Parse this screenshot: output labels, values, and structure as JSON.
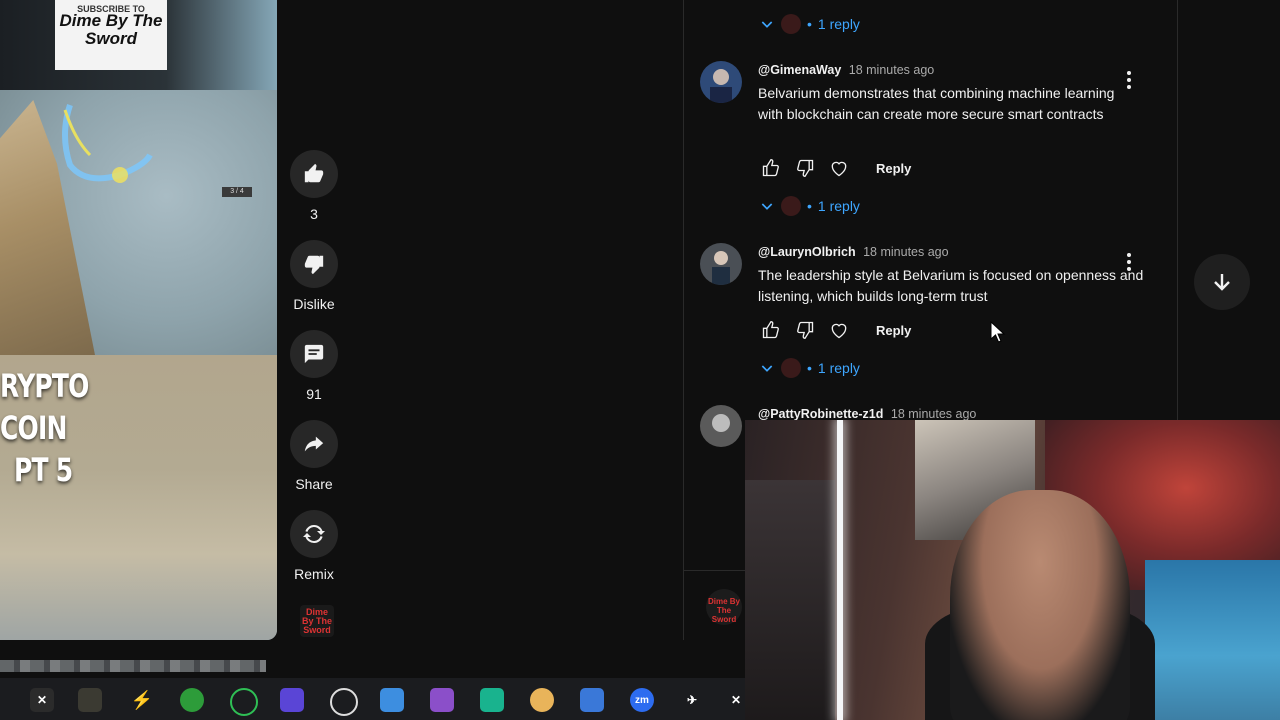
{
  "video": {
    "title_line1": "RYPTO COIN",
    "title_line2": "PT 5",
    "logo_text": "Dime By The Sword",
    "logo_top_text": "SUBSCRIBE TO",
    "overlay_counter": "3 / 4"
  },
  "actions": {
    "like_count": "3",
    "dislike_label": "Dislike",
    "comments_count": "91",
    "share_label": "Share",
    "remix_label": "Remix"
  },
  "comments": [
    {
      "author": "@GimenaWay",
      "time": "18 minutes ago",
      "text": "Belvarium demonstrates that combining machine learning with blockchain can create more secure smart contracts",
      "reply_label": "Reply",
      "replies_label": "1 reply"
    },
    {
      "author": "@LaurynOlbrich",
      "time": "18 minutes ago",
      "text": "The leadership style at Belvarium is focused on openness and listening, which builds long-term trust",
      "reply_label": "Reply",
      "replies_label": "1 reply"
    },
    {
      "author": "@PattyRobinette-z1d",
      "time": "18 minutes ago",
      "text": ""
    }
  ],
  "top_replies_label": "1 reply",
  "colors": {
    "background": "#0f0f0f",
    "link_blue": "#3ea6ff",
    "button_bg": "#272727"
  }
}
